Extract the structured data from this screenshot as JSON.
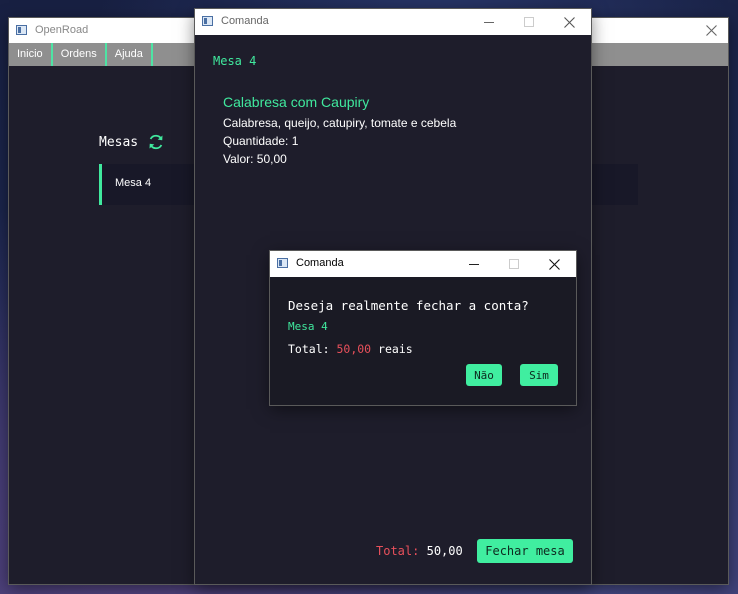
{
  "main_window": {
    "title": "OpenRoad",
    "menu": [
      "Inicio",
      "Ordens",
      "Ajuda"
    ],
    "mesas_heading": "Mesas",
    "table_items": [
      {
        "label": "Mesa 4"
      }
    ]
  },
  "order_window": {
    "title": "Comanda",
    "table": "Mesa 4",
    "item": {
      "name": "Calabresa com Caupiry",
      "description": "Calabresa, queijo, catupiry, tomate e cebela",
      "quantity": "Quantidade: 1",
      "value": "Valor: 50,00"
    },
    "total_label": "Total:",
    "total_value": "50,00",
    "close_button": "Fechar mesa"
  },
  "dialog": {
    "title": "Comanda",
    "question": "Deseja realmente fechar a conta?",
    "table": "Mesa 4",
    "total_prefix": "Total:",
    "total_amount": "50,00",
    "total_suffix": "reais",
    "no_button": "Não",
    "yes_button": "Sim"
  },
  "colors": {
    "accent_green": "#40e99e",
    "total_red": "#e8505b",
    "window_bg": "#1e1d2b",
    "dialog_bg": "#1a1a24"
  }
}
